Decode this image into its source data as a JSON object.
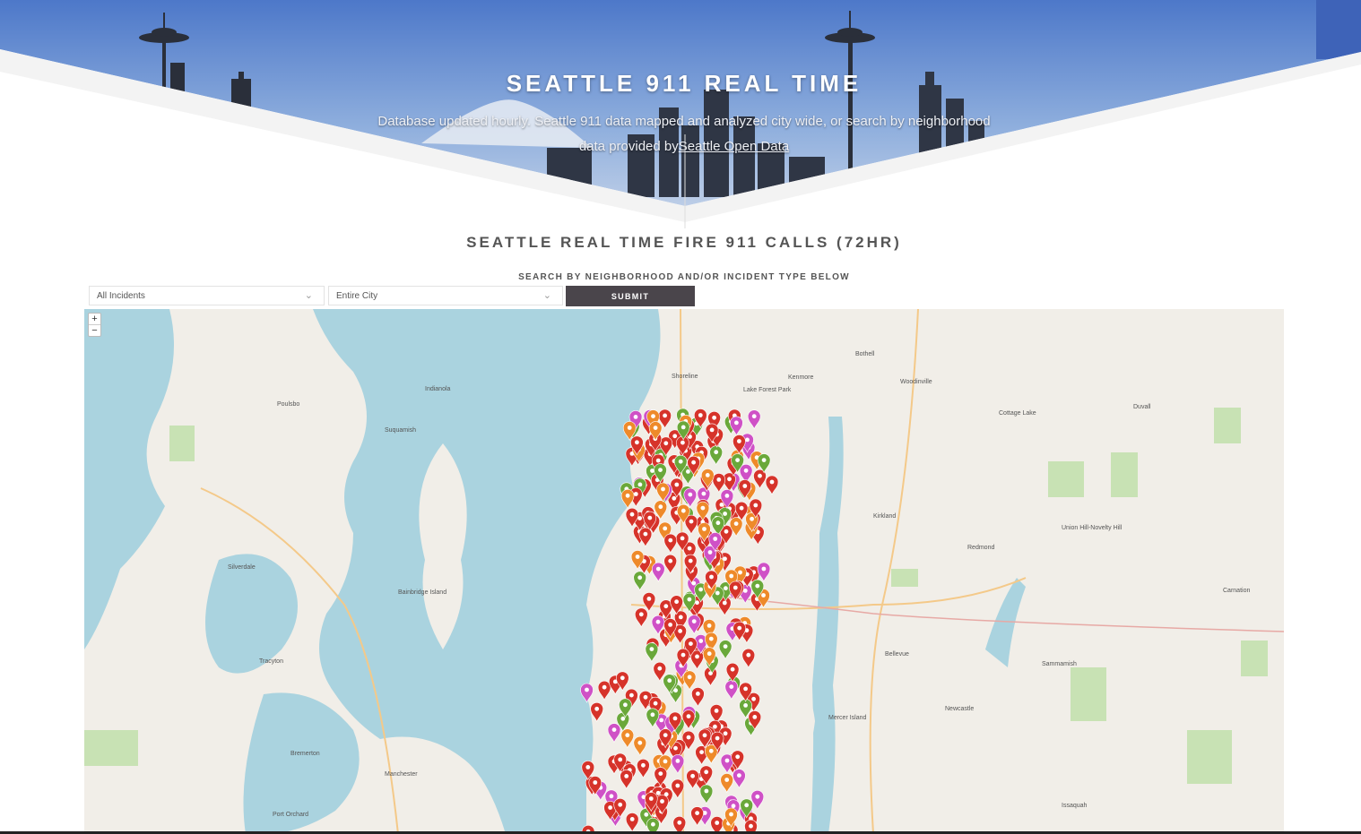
{
  "hero": {
    "title": "SEATTLE 911 REAL TIME",
    "subtitle_line1": "Database updated hourly. Seattle 911 data mapped and analyzed city wide, or search by neighborhood",
    "subtitle_line2_prefix": "data provided by",
    "subtitle_link": "Seattle Open Data"
  },
  "section": {
    "title": "SEATTLE REAL TIME FIRE 911 CALLS (72HR)",
    "search_label": "SEARCH BY NEIGHBORHOOD AND/OR INCIDENT TYPE BELOW"
  },
  "filters": {
    "incident_type": "All Incidents",
    "neighborhood": "Entire City",
    "submit_label": "SUBMIT"
  },
  "map": {
    "zoom_in": "+",
    "zoom_out": "−",
    "place_labels": [
      "Shoreline",
      "Lake Forest Park",
      "Kenmore",
      "Bothell",
      "Woodinville",
      "Kirkland",
      "Redmond",
      "Bellevue",
      "Mercer Island",
      "Sammamish",
      "Issaquah",
      "Newcastle",
      "Poulsbo",
      "Suquamish",
      "Indianola",
      "Bainbridge Island",
      "Silverdale",
      "Tracyton",
      "Bremerton",
      "Port Orchard",
      "Manchester",
      "Cottage Lake",
      "Duvall",
      "Carnation",
      "Union Hill-Novelty Hill"
    ],
    "marker_colors": {
      "medical": "#d6332a",
      "aid": "#cf51c6",
      "fire": "#6aa83a",
      "other": "#ee8a2a"
    }
  }
}
